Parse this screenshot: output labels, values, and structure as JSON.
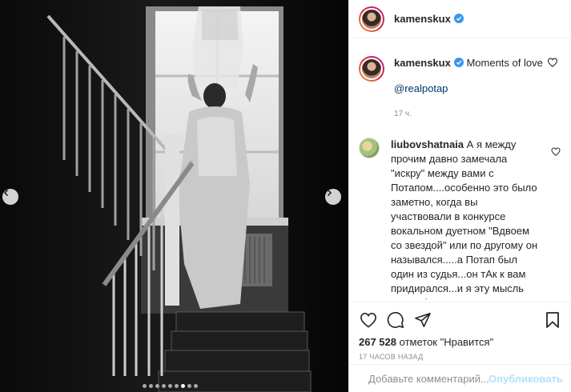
{
  "post": {
    "username": "kamenskux",
    "caption_user": "kamenskux",
    "caption_text": "Moments of love",
    "mention": "@realpotap",
    "caption_time": "17 ч.",
    "comment": {
      "username": "liubovshatnaia",
      "text": "А я между прочим давно замечала \"искру\" между вами с Потапом....особенно это было заметно, когда вы участвовали в конкурсе вокальном дуетном \"Вдвоем со звездой\" или по другому он назывался.....а Потап был один из судья...он тАк к вам придирался...и я эту мысль про себя отметила, что только влюбленный так придирается)))))🔥🔥🔥 будьте счастливы!!!!❤❤❤❤"
    },
    "likes_count": "267 528",
    "likes_suffix": "отметок \"Нравится\"",
    "post_time": "17 часов назад"
  },
  "add_comment": {
    "placeholder": "Добавьте комментарий...",
    "publish_label": "Опубликовать"
  },
  "carousel": {
    "slide_count": 9,
    "active_index": 6
  },
  "icons": {
    "verified": "verified-badge-icon",
    "heart": "heart-icon",
    "comment": "comment-icon",
    "share": "share-icon",
    "save": "bookmark-icon",
    "emoji": "emoji-icon",
    "prev": "chevron-left-icon",
    "next": "chevron-right-icon"
  },
  "colors": {
    "verified": "#3897f0",
    "link": "#00376b",
    "publish": "#b2dffc",
    "muted": "#8e8e8e"
  }
}
